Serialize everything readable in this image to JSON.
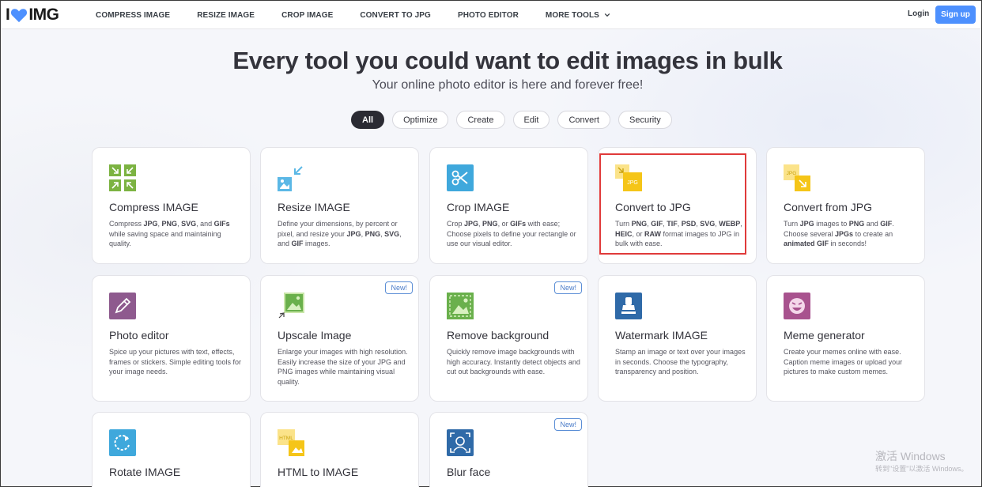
{
  "brand": {
    "logo_left": "I",
    "logo_right": "IMG"
  },
  "nav": {
    "items": [
      "COMPRESS IMAGE",
      "RESIZE IMAGE",
      "CROP IMAGE",
      "CONVERT TO JPG",
      "PHOTO EDITOR"
    ],
    "more": "MORE TOOLS"
  },
  "auth": {
    "login": "Login",
    "signup": "Sign up"
  },
  "hero": {
    "title": "Every tool you could want to edit images in bulk",
    "subtitle": "Your online photo editor is here and forever free!"
  },
  "filters": [
    "All",
    "Optimize",
    "Create",
    "Edit",
    "Convert",
    "Security"
  ],
  "active_filter": "All",
  "cards": [
    {
      "title": "Compress IMAGE",
      "desc_html": "Compress <b>JPG</b>, <b>PNG</b>, <b>SVG</b>, and <b>GIFs</b> while saving space and maintaining quality.",
      "icon": "compress-icon",
      "color": "#7cb342"
    },
    {
      "title": "Resize IMAGE",
      "desc_html": "Define your dimensions, by percent or pixel, and resize your <b>JPG</b>, <b>PNG</b>, <b>SVG</b>, and <b>GIF</b> images.",
      "icon": "resize-icon",
      "color": "#5bb8e6"
    },
    {
      "title": "Crop IMAGE",
      "desc_html": "Crop <b>JPG</b>, <b>PNG</b>, or <b>GIFs</b> with ease; Choose pixels to define your rectangle or use our visual editor.",
      "icon": "crop-icon",
      "color": "#3fa8dc"
    },
    {
      "title": "Convert to JPG",
      "desc_html": "Turn <b>PNG</b>, <b>GIF</b>, <b>TIF</b>, <b>PSD</b>, <b>SVG</b>, <b>WEBP</b>, <b>HEIC</b>, or <b>RAW</b> format images to JPG in bulk with ease.",
      "icon": "convert-to-jpg-icon",
      "color": "#f5c518",
      "icon_text": "JPG"
    },
    {
      "title": "Convert from JPG",
      "desc_html": "Turn <b>JPG</b> images to <b>PNG</b> and <b>GIF</b>. Choose several <b>JPGs</b> to create an <b>animated GIF</b> in seconds!",
      "icon": "convert-from-jpg-icon",
      "color": "#f5c518",
      "icon_text": "JPG"
    },
    {
      "title": "Photo editor",
      "desc_html": "Spice up your pictures with text, effects, frames or stickers. Simple editing tools for your image needs.",
      "icon": "photo-editor-icon",
      "color": "#8e5a8e"
    },
    {
      "title": "Upscale Image",
      "desc_html": "Enlarge your images with high resolution. Easily increase the size of your JPG and PNG images while maintaining visual quality.",
      "icon": "upscale-icon",
      "color": "#6ab04c",
      "badge": "New!"
    },
    {
      "title": "Remove background",
      "desc_html": "Quickly remove image backgrounds with high accuracy. Instantly detect objects and cut out backgrounds with ease.",
      "icon": "remove-background-icon",
      "color": "#6ab04c",
      "badge": "New!"
    },
    {
      "title": "Watermark IMAGE",
      "desc_html": "Stamp an image or text over your images in seconds. Choose the typography, transparency and position.",
      "icon": "watermark-icon",
      "color": "#2f6aa8"
    },
    {
      "title": "Meme generator",
      "desc_html": "Create your memes online with ease. Caption meme images or upload your pictures to make custom memes.",
      "icon": "meme-icon",
      "color": "#a8528e"
    },
    {
      "title": "Rotate IMAGE",
      "desc_html": "",
      "icon": "rotate-icon",
      "color": "#3fa8dc"
    },
    {
      "title": "HTML to IMAGE",
      "desc_html": "",
      "icon": "html-to-image-icon",
      "color": "#f5c518",
      "icon_text": "HTML"
    },
    {
      "title": "Blur face",
      "desc_html": "",
      "icon": "blur-face-icon",
      "color": "#2f6aa8",
      "badge": "New!"
    }
  ],
  "os_watermark": {
    "line1": "激活 Windows",
    "line2": "转到\"设置\"以激活 Windows。"
  },
  "accent_colors": {
    "signup": "#4d90fe",
    "highlight": "#e03a3a",
    "active_filter": "#2b2b33"
  }
}
